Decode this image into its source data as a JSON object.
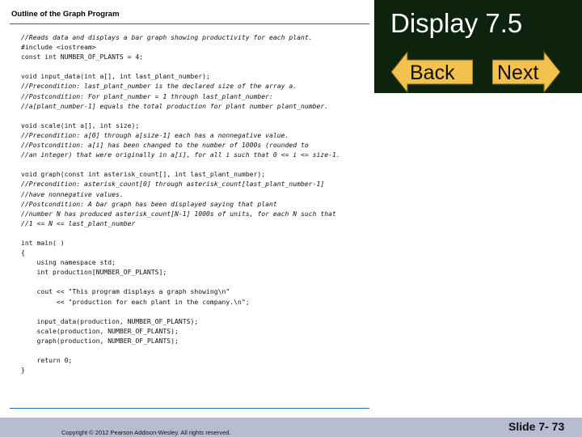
{
  "header": {
    "title": "Display 7.5",
    "back_label": "Back",
    "next_label": "Next",
    "background_color": "#0e230e",
    "arrow_color": "#f2c14e"
  },
  "code_panel": {
    "title": "Outline of the Graph Program",
    "lines": [
      "//Reads data and displays a bar graph showing productivity for each plant.",
      "#include <iostream>",
      "const int NUMBER_OF_PLANTS = 4;",
      "",
      "void input_data(int a[], int last_plant_number);",
      "//Precondition: last_plant_number is the declared size of the array a.",
      "//Postcondition: For plant_number = 1 through last_plant_number:",
      "//a[plant_number-1] equals the total production for plant number plant_number.",
      "",
      "void scale(int a[], int size);",
      "//Precondition: a[0] through a[size-1] each has a nonnegative value.",
      "//Postcondition: a[i] has been changed to the number of 1000s (rounded to",
      "//an integer) that were originally in a[i], for all i such that 0 <= i <= size-1.",
      "",
      "void graph(const int asterisk_count[], int last_plant_number);",
      "//Precondition: asterisk_count[0] through asterisk_count[last_plant_number-1]",
      "//have nonnegative values.",
      "//Postcondition: A bar graph has been displayed saying that plant",
      "//number N has produced asterisk_count[N-1] 1000s of units, for each N such that",
      "//1 <= N <= last_plant_number",
      "",
      "int main( )",
      "{",
      "    using namespace std;",
      "    int production[NUMBER_OF_PLANTS];",
      "",
      "    cout << \"This program displays a graph showing\\n\"",
      "         << \"production for each plant in the company.\\n\";",
      "",
      "    input_data(production, NUMBER_OF_PLANTS);",
      "    scale(production, NUMBER_OF_PLANTS);",
      "    graph(production, NUMBER_OF_PLANTS);",
      "",
      "    return 0;",
      "}"
    ]
  },
  "footer": {
    "copyright": "Copyright © 2012 Pearson Addison-Wesley.  All rights reserved.",
    "slide_number": "Slide 7- 73",
    "background_color": "#b8bcd0"
  }
}
